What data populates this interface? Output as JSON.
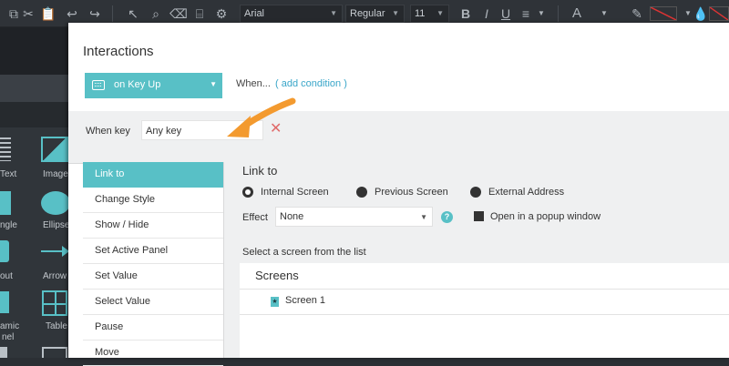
{
  "toolbar": {
    "font_family": "Arial",
    "font_weight": "Regular",
    "font_size": "11",
    "text_color_label": "A"
  },
  "widgets": {
    "items": [
      "Text",
      "Image",
      "ngle",
      "Ellipse",
      "out",
      "Arrow",
      "amic",
      "nel",
      "Table"
    ]
  },
  "dialog": {
    "title": "Interactions",
    "event_select": "on Key Up",
    "when_label": "When...",
    "add_condition": "( add condition )",
    "when_key_label": "When key",
    "when_key_value": "Any key"
  },
  "actions": {
    "items": [
      "Link to",
      "Change Style",
      "Show / Hide",
      "Set Active Panel",
      "Set Value",
      "Select Value",
      "Pause",
      "Move"
    ],
    "active": "Link to"
  },
  "link": {
    "title": "Link to",
    "options": [
      "Internal Screen",
      "Previous Screen",
      "External Address"
    ],
    "selected": "Internal Screen",
    "effect_label": "Effect",
    "effect_value": "None",
    "popup_label": "Open in a popup window",
    "select_prompt": "Select a screen from the list",
    "screens_header": "Screens",
    "screens": [
      "Screen 1"
    ]
  },
  "colors": {
    "accent": "#58c0c6",
    "link": "#3aa6c9",
    "delete": "#e06a6a",
    "annotation_arrow": "#f39a2f"
  }
}
